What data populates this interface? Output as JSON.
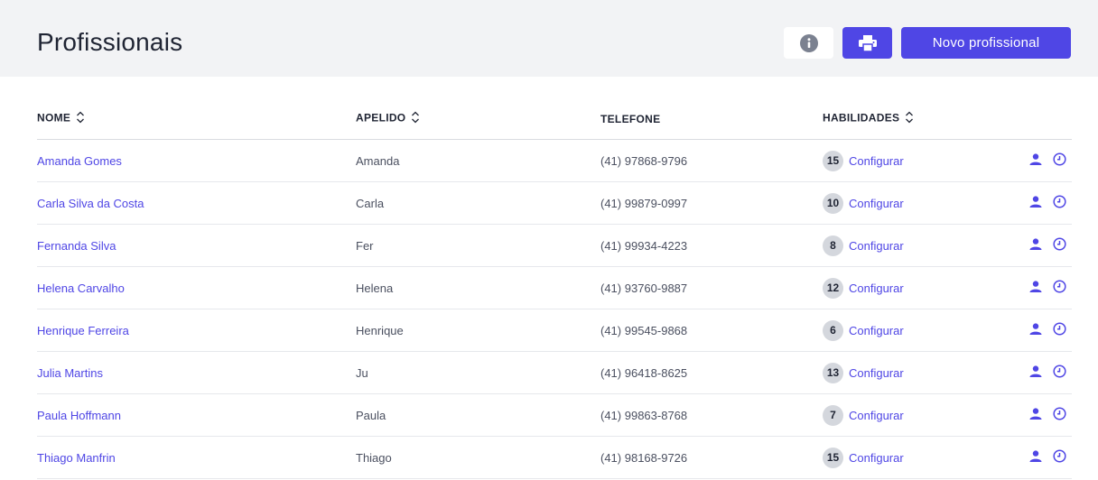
{
  "header": {
    "title": "Profissionais",
    "new_button_label": "Novo profissional"
  },
  "colors": {
    "accent": "#4f46e5",
    "header_bg": "#f2f3f5",
    "badge_bg": "#d4d7dd"
  },
  "icons": {
    "info": "info-circle-icon",
    "print": "printer-icon",
    "user": "user-icon",
    "clock": "clock-icon",
    "sort": "sort-icon"
  },
  "table": {
    "columns": [
      "NOME",
      "APELIDO",
      "TELEFONE",
      "HABILIDADES"
    ],
    "config_label": "Configurar",
    "rows": [
      {
        "name": "Amanda Gomes",
        "nickname": "Amanda",
        "phone": "(41) 97868-9796",
        "skills": "15"
      },
      {
        "name": "Carla Silva da Costa",
        "nickname": "Carla",
        "phone": "(41) 99879-0997",
        "skills": "10"
      },
      {
        "name": "Fernanda Silva",
        "nickname": "Fer",
        "phone": "(41) 99934-4223",
        "skills": "8"
      },
      {
        "name": "Helena Carvalho",
        "nickname": "Helena",
        "phone": "(41) 93760-9887",
        "skills": "12"
      },
      {
        "name": "Henrique Ferreira",
        "nickname": "Henrique",
        "phone": "(41) 99545-9868",
        "skills": "6"
      },
      {
        "name": "Julia Martins",
        "nickname": "Ju",
        "phone": "(41) 96418-8625",
        "skills": "13"
      },
      {
        "name": "Paula Hoffmann",
        "nickname": "Paula",
        "phone": "(41) 99863-8768",
        "skills": "7"
      },
      {
        "name": "Thiago Manfrin",
        "nickname": "Thiago",
        "phone": "(41) 98168-9726",
        "skills": "15"
      }
    ]
  }
}
